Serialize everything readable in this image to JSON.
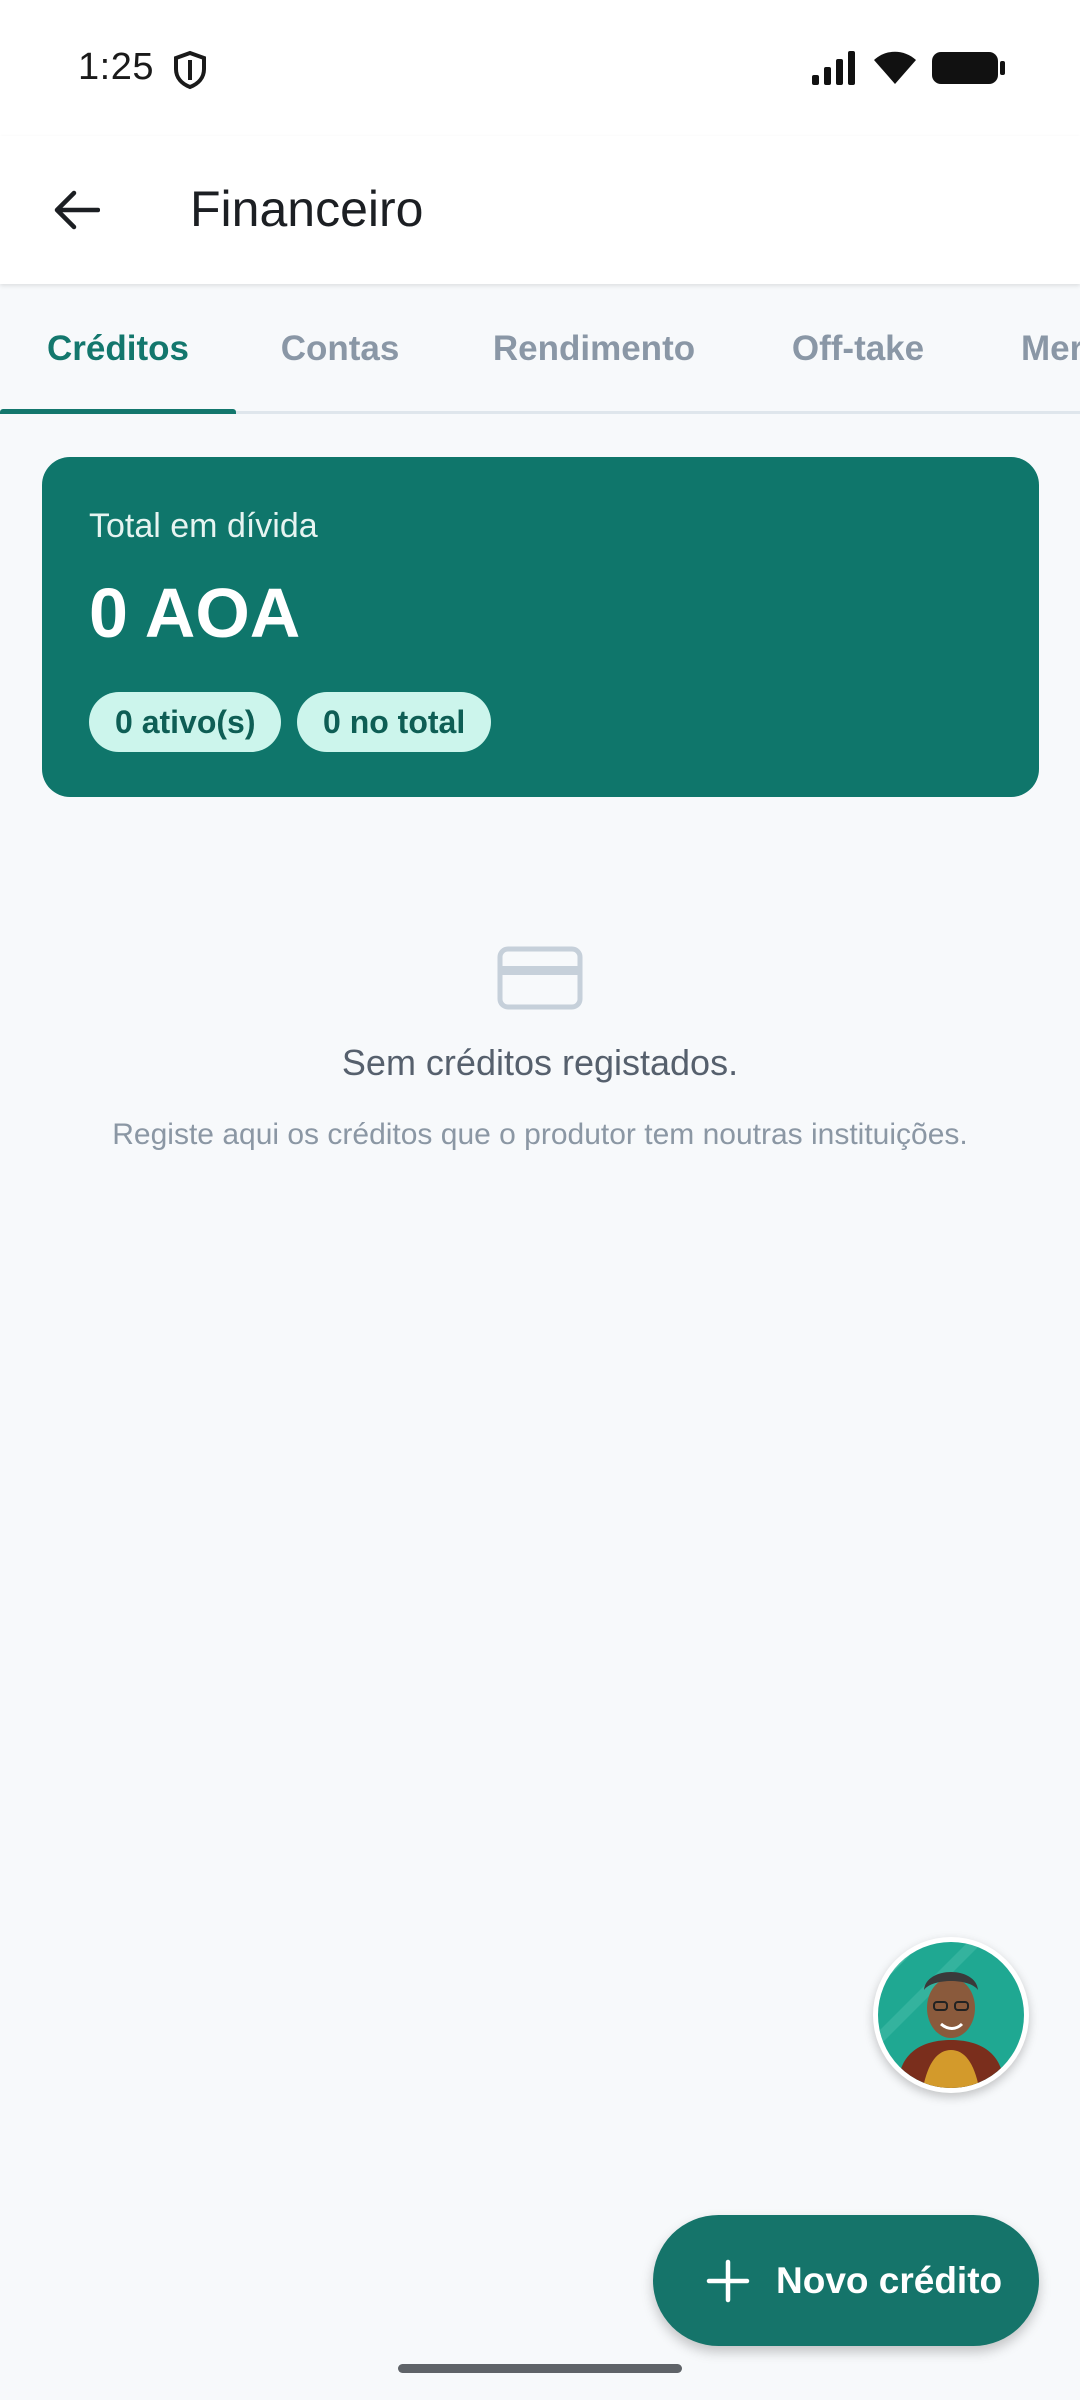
{
  "status_bar": {
    "time": "1:25",
    "icons": [
      "shield-icon",
      "signal-icon",
      "wifi-icon",
      "battery-icon"
    ]
  },
  "app_bar": {
    "back_icon": "arrow-left-icon",
    "title": "Financeiro"
  },
  "tabs": [
    {
      "label": "Créditos",
      "active": true
    },
    {
      "label": "Contas",
      "active": false
    },
    {
      "label": "Rendimento",
      "active": false
    },
    {
      "label": "Off-take",
      "active": false
    },
    {
      "label": "Mer",
      "active": false
    }
  ],
  "summary": {
    "label": "Total em dívida",
    "amount": "0 AOA",
    "chips": [
      "0 ativo(s)",
      "0 no total"
    ]
  },
  "empty_state": {
    "icon": "credit-card-icon",
    "title": "Sem créditos registados.",
    "subtitle": "Registe aqui os créditos que o produtor tem noutras instituições."
  },
  "assistant": {
    "icon": "assistant-avatar"
  },
  "fab": {
    "icon": "plus-icon",
    "label": "Novo crédito"
  },
  "colors": {
    "primary": "#0f766b",
    "chip_bg": "#ccf5ec",
    "background": "#f7f9fb",
    "tab_inactive": "#8a97a6"
  }
}
